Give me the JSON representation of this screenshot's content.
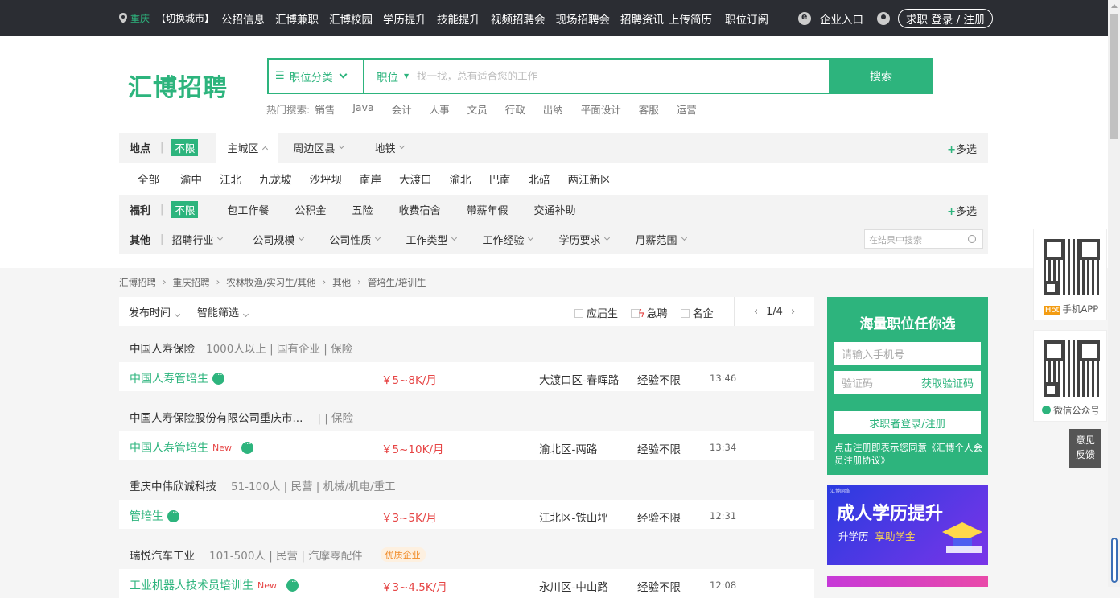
{
  "topbar": {
    "city": "重庆",
    "switch_city": "【切换城市】",
    "nav": [
      "公招信息",
      "汇博兼职",
      "汇博校园",
      "学历提升",
      "技能提升",
      "视频招聘会",
      "现场招聘会",
      "招聘资讯"
    ],
    "upload_resume": "上传简历",
    "job_subscribe": "职位订阅",
    "enterprise_entry": "企业入口",
    "login_register": "求职 登录 / 注册"
  },
  "header": {
    "logo": "汇博招聘",
    "category_button": "职位分类",
    "position_select": "职位",
    "search_placeholder": "找一找，总有适合您的工作",
    "search_button": "搜索",
    "hot_label": "热门搜索:",
    "hot_keywords": [
      "销售",
      "Java",
      "会计",
      "人事",
      "文员",
      "行政",
      "出纳",
      "平面设计",
      "客服",
      "运营"
    ]
  },
  "filters": {
    "location": {
      "label": "地点",
      "unlimited": "不限",
      "options": [
        "主城区",
        "周边区县",
        "地铁"
      ],
      "multi": "多选",
      "districts": [
        "全部",
        "渝中",
        "江北",
        "九龙坡",
        "沙坪坝",
        "南岸",
        "大渡口",
        "渝北",
        "巴南",
        "北碚",
        "两江新区"
      ]
    },
    "benefits": {
      "label": "福利",
      "unlimited": "不限",
      "options": [
        "包工作餐",
        "公积金",
        "五险",
        "收费宿舍",
        "带薪年假",
        "交通补助"
      ],
      "multi": "多选"
    },
    "other": {
      "label": "其他",
      "options": [
        "招聘行业",
        "公司规模",
        "公司性质",
        "工作类型",
        "工作经验",
        "学历要求",
        "月薪范围"
      ],
      "search_placeholder": "在结果中搜索"
    }
  },
  "breadcrumb": [
    "汇博招聘",
    "重庆招聘",
    "农林牧渔/实习生/其他",
    "其他",
    "管培生/培训生"
  ],
  "sortbar": {
    "publish_time": "发布时间",
    "smart_filter": "智能筛选",
    "fresh_grad": "应届生",
    "urgent": "急聘",
    "famous": "名企",
    "page": "1/4"
  },
  "jobs": [
    {
      "company": "中国人寿保险",
      "meta": "1000人以上 | 国有企业 | 保险",
      "title": "中国人寿管培生",
      "new": "",
      "salary": "￥5~8K/月",
      "area": "大渡口区-春晖路",
      "exp": "经验不限",
      "time": "13:46",
      "badge": ""
    },
    {
      "company": "中国人寿保险股份有限公司重庆市...",
      "meta": "| | 保险",
      "title": "中国人寿管培生",
      "new": "New",
      "salary": "￥5~10K/月",
      "area": "渝北区-两路",
      "exp": "经验不限",
      "time": "13:34",
      "badge": ""
    },
    {
      "company": "重庆中伟欣诚科技",
      "meta": "51-100人 | 民营 | 机械/机电/重工",
      "title": "管培生",
      "new": "",
      "salary": "￥3~5K/月",
      "area": "江北区-铁山坪",
      "exp": "经验不限",
      "time": "12:31",
      "badge": ""
    },
    {
      "company": "瑞悦汽车工业",
      "meta": "101-500人 | 民营 | 汽摩零配件",
      "title": "工业机器人技术员培训生",
      "new": "New",
      "salary": "￥3~4.5K/月",
      "area": "永川区-中山路",
      "exp": "经验不限",
      "time": "12:08",
      "badge": "优质企业"
    }
  ],
  "side": {
    "heading": "海量职位任你选",
    "phone_placeholder": "请输入手机号",
    "code_placeholder": "验证码",
    "get_code": "获取验证码",
    "login_button": "求职者登录/注册",
    "agreement": "点击注册即表示您同意《汇博个人会员注册协议》"
  },
  "banner": {
    "brand": "汇博网络",
    "title": "成人学历提升",
    "sub1": "升学历",
    "sub2": "享助学金"
  },
  "qr": {
    "app_hot": "Hot",
    "app_label": "手机APP",
    "wechat_label": "微信公众号"
  },
  "feedback": [
    "意见",
    "反馈"
  ]
}
